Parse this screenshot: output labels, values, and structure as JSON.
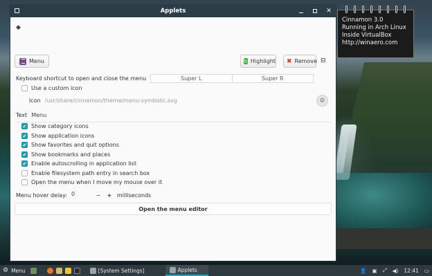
{
  "window": {
    "title": "Applets"
  },
  "toolbar": {
    "menu_label": "Menu",
    "highlight_label": "Highlight",
    "remove_label": "Remove"
  },
  "settings": {
    "shortcut_label": "Keyboard shortcut to open and close the menu",
    "shortcut_primary": "Super L",
    "shortcut_secondary": "Super R",
    "custom_icon_label": "Use a custom icon",
    "custom_icon_checked": false,
    "icon_label": "Icon",
    "icon_path": "/usr/share/cinnamon/theme/menu-symbolic.svg",
    "text_label": "Text",
    "text_value": "Menu",
    "options": [
      {
        "label": "Show category icons",
        "checked": true
      },
      {
        "label": "Show application icons",
        "checked": true
      },
      {
        "label": "Show favorites and quit options",
        "checked": true
      },
      {
        "label": "Show bookmarks and places",
        "checked": true
      },
      {
        "label": "Enable autoscrolling in application list",
        "checked": true
      },
      {
        "label": "Enable filesystem path entry in search box",
        "checked": false
      },
      {
        "label": "Open the menu when I move my mouse over it",
        "checked": false
      }
    ],
    "hover_delay_label": "Menu hover delay:",
    "hover_delay_value": "0",
    "hover_delay_minus": "−",
    "hover_delay_plus": "+",
    "hover_delay_unit": "milliseconds",
    "editor_button": "Open the menu editor"
  },
  "note": {
    "lines": [
      "Cinnamon 3.0",
      "Running in Arch Linux",
      "Inside VirtualBox",
      "http://winaero.com"
    ]
  },
  "taskbar": {
    "menu_label": "Menu",
    "tasks": [
      "[System Settings]",
      "Applets"
    ],
    "clock": "12:41"
  }
}
